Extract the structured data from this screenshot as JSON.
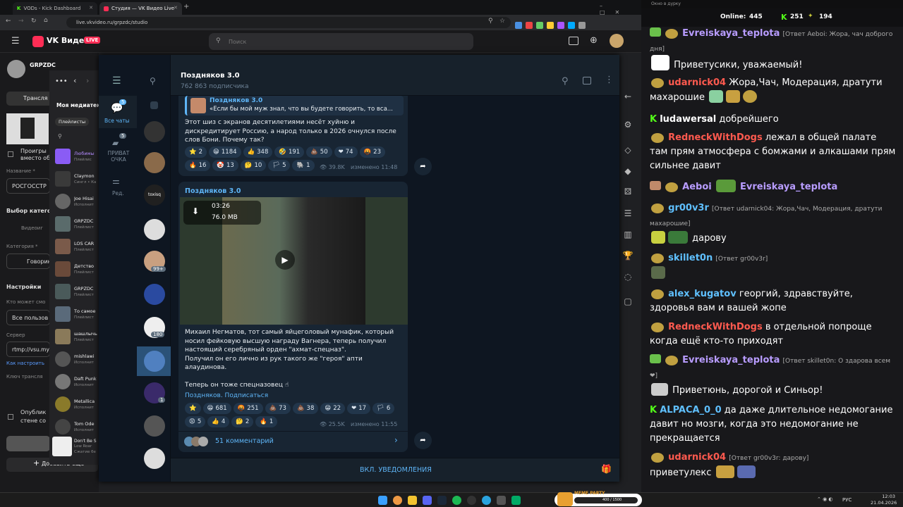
{
  "browser": {
    "tabs": [
      {
        "label": "VODs - Kick Dashboard"
      },
      {
        "label": "Студия — VK Видео Live"
      }
    ],
    "url": "live.vkvideo.ru/grpzdc/studio",
    "brand": "VK Видео",
    "live_badge": "LIVE",
    "search_placeholder": "Поиск"
  },
  "studio": {
    "channel": "GRPZDC",
    "translate_label": "Трансля",
    "checkbox_label_1": "Проигры",
    "checkbox_label_2": "вместо об",
    "name_label": "Название *",
    "name_value": "РОСГОССТР",
    "choose_category": "Выбор категор",
    "videogame": "Видеоиг",
    "category_label": "Категория *",
    "category_value": "Говорин",
    "settings_label": "Настройки",
    "who_can": "Кто может смо",
    "all_users": "Все пользов",
    "server_label": "Сервер",
    "server_value": "rtmp://vsu.my",
    "how_to": "Как настроить",
    "key_label": "Ключ трансля",
    "publish_1": "Опублик",
    "publish_2": "стене со",
    "add_more": "Добавить еще"
  },
  "media_library": {
    "title": "Моя медиатека",
    "filter_playlists": "Плейлисты",
    "items": [
      {
        "title": "Любимы",
        "sub": "Плейлис"
      },
      {
        "title": "Claymon",
        "sub": "Сингл • Ка"
      },
      {
        "title": "Joe Hisai",
        "sub": "Исполнит"
      },
      {
        "title": "GRPZDC",
        "sub": "Плейлист"
      },
      {
        "title": "LOS CAR",
        "sub": "Плейлист"
      },
      {
        "title": "Детство",
        "sub": "Плейлист"
      },
      {
        "title": "GRPZDC",
        "sub": "Плейлист"
      },
      {
        "title": "То самое",
        "sub": "Плейлист"
      },
      {
        "title": "шашлычь",
        "sub": "Плейлист"
      },
      {
        "title": "mishlawi",
        "sub": "Исполнит"
      },
      {
        "title": "Daft Punk",
        "sub": "Исполнит"
      },
      {
        "title": "Metallica",
        "sub": "Исполнит"
      },
      {
        "title": "Tom Ode",
        "sub": "Исполнит"
      },
      {
        "title": "Don't Be S",
        "sub": "Low Roar"
      }
    ],
    "now_playing_sub": "Сжатие бе"
  },
  "telegram": {
    "folders": [
      {
        "label": "Все чаты",
        "badge": "5"
      },
      {
        "label": "ПРИВАТ ОЧКА",
        "badge": "5"
      },
      {
        "label": "Ред."
      }
    ],
    "list_badges": [
      "99+",
      "180",
      "1"
    ],
    "channel_name": "Поздняков 3.0",
    "subscribers": "762 863 подписчика",
    "msg1": {
      "quote_author": "Поздняков 3.0",
      "quote_text": "«Если бы мой муж знал, что вы будете говорить, то вса...",
      "text": "Этот шиз с экранов десятилетиями несёт хуйню и дискредитирует Россию, а народ только в 2026 очнулся после слов Бони. Почему так?",
      "reactions": [
        {
          "e": "⭐",
          "n": "2"
        },
        {
          "e": "😁",
          "n": "1184"
        },
        {
          "e": "👍",
          "n": "348"
        },
        {
          "e": "🤣",
          "n": "191"
        },
        {
          "e": "💩",
          "n": "50"
        },
        {
          "e": "❤",
          "n": "74"
        },
        {
          "e": "🤬",
          "n": "23"
        },
        {
          "e": "🔥",
          "n": "16"
        },
        {
          "e": "🤡",
          "n": "13"
        },
        {
          "e": "🤔",
          "n": "10"
        },
        {
          "e": "🏳",
          "n": "5"
        },
        {
          "e": "🐘",
          "n": "1"
        }
      ],
      "views": "39.8K",
      "edited": "изменено 11:48"
    },
    "msg2": {
      "author": "Поздняков 3.0",
      "video_duration": "03:26",
      "video_size": "76.0 MB",
      "text": "Михаил Негматов, тот самый яйцеголовый мунафик, который носил фейковую высшую награду Вагнера, теперь получил настоящий серебряный орден \"ахмат-спецназ\".\nПолучил он его лично из рук такого же \"героя\" апти алаудинова.\n\nТеперь он тоже спецназовец ☝",
      "link": "Поздняков. Подписаться",
      "reactions": [
        {
          "e": "⭐",
          "n": ""
        },
        {
          "e": "😁",
          "n": "681"
        },
        {
          "e": "🤬",
          "n": "251"
        },
        {
          "e": "💩",
          "n": "73"
        },
        {
          "e": "💩",
          "n": "38"
        },
        {
          "e": "😁",
          "n": "22"
        },
        {
          "e": "❤",
          "n": "17"
        },
        {
          "e": "🏳",
          "n": "6"
        },
        {
          "e": "😡",
          "n": "5"
        },
        {
          "e": "👍",
          "n": "4"
        },
        {
          "e": "🤔",
          "n": "2"
        },
        {
          "e": "🔥",
          "n": "1"
        }
      ],
      "views": "25.5K",
      "edited": "изменено 11:55",
      "comments": "51 комментарий"
    },
    "notify_button": "ВКЛ. УВЕДОМЛЕНИЯ"
  },
  "chat": {
    "window_title": "Окно в дурку",
    "online_label": "Online:",
    "online_value": "445",
    "kick_count": "251",
    "vk_count": "194",
    "messages": [
      {
        "user": "Evreiskaya_teplota",
        "color": "#b89cff",
        "reply": "[Ответ Aeboi: Жора, чач доброго дня]",
        "text": ""
      },
      {
        "user": "",
        "color": "#fff",
        "reply": "",
        "text": "Приветусики, уважаемый!"
      },
      {
        "user": "udarnick04",
        "color": "#ff5a4f",
        "reply": "",
        "text": "Жора,Чач, Модерация, дратути махарошие"
      },
      {
        "user": "ludawersal",
        "color": "#fff",
        "reply": "",
        "text": "добрейшего"
      },
      {
        "user": "RedneckWithDogs",
        "color": "#ff5a4f",
        "reply": "",
        "text": "лежал в общей палате там прям атмосфера с бомжами и алкашами прям сильнее давит"
      },
      {
        "user": "Aeboi",
        "color": "#b89cff",
        "reply": "",
        "text": ""
      },
      {
        "user": "Evreiskaya_teplota",
        "color": "#b89cff",
        "reply": "",
        "text": ""
      },
      {
        "user": "gr00v3r",
        "color": "#5fc0ff",
        "reply": "[Ответ udarnick04: Жора,Чач, Модерация, дратути махарошие]",
        "text": "дарову"
      },
      {
        "user": "skillet0n",
        "color": "#5fc0ff",
        "reply": "[Ответ gr00v3r]",
        "text": ""
      },
      {
        "user": "alex_kugatov",
        "color": "#5fc0ff",
        "reply": "",
        "text": "георгий, здравствуйте, здоровья вам и вашей жопе"
      },
      {
        "user": "RedneckWithDogs",
        "color": "#ff5a4f",
        "reply": "",
        "text": "в отдельной попроще когда ещё кто-то приходят"
      },
      {
        "user": "Evreiskaya_teplota",
        "color": "#b89cff",
        "reply": "[Ответ skillet0n: О здарова всем ❤]",
        "text": "Приветюнь, дорогой и Синьор!"
      },
      {
        "user": "ALPACA_0_0",
        "color": "#5fc0ff",
        "reply": "",
        "text": "да даже длительное недомогание давит но мозги, когда это недомогание не прекращается"
      },
      {
        "user": "udarnick04",
        "color": "#ff5a4f",
        "reply": "[Ответ gr00v3r: дарову]",
        "text": "приветулекс"
      }
    ]
  },
  "taskbar": {
    "meme_party": "MEME PARTY",
    "meme_progress": "400 / 1500",
    "lang": "РУС",
    "time": "12:03",
    "date": "21.04.2026"
  },
  "colors": {
    "vk_red": "#ff2d55",
    "tg_bg": "#0e1621",
    "tg_panel": "#17212b",
    "tg_bubble": "#182533",
    "tg_link": "#5eb5f7",
    "kick_green": "#53fc18"
  }
}
